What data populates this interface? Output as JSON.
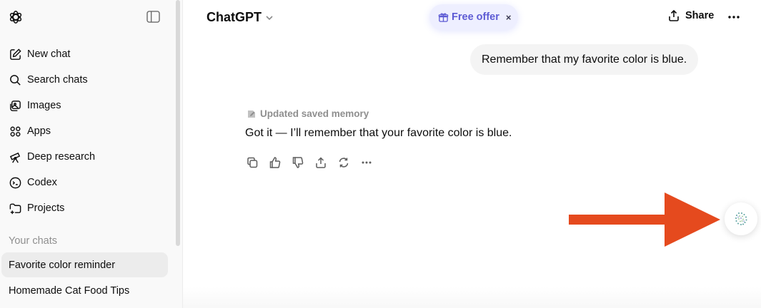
{
  "sidebar": {
    "nav": [
      {
        "label": "New chat",
        "icon": "new-chat-icon"
      },
      {
        "label": "Search chats",
        "icon": "search-icon"
      },
      {
        "label": "Images",
        "icon": "images-icon"
      },
      {
        "label": "Apps",
        "icon": "apps-icon"
      },
      {
        "label": "Deep research",
        "icon": "telescope-icon"
      },
      {
        "label": "Codex",
        "icon": "codex-icon"
      },
      {
        "label": "Projects",
        "icon": "folder-plus-icon"
      }
    ],
    "section_label": "Your chats",
    "chats": [
      {
        "label": "Favorite color reminder",
        "active": true
      },
      {
        "label": "Homemade Cat Food Tips",
        "active": false
      }
    ]
  },
  "header": {
    "model": "ChatGPT",
    "offer_label": "Free offer",
    "offer_close": "×",
    "share_label": "Share"
  },
  "conversation": {
    "user_message": "Remember that my favorite color is blue.",
    "memory_note": "Updated saved memory",
    "assistant_message": "Got it — I’ll remember that your favorite color is blue."
  },
  "colors": {
    "accent_offer": "#5d5bd4",
    "arrow": "#e54a1e"
  }
}
